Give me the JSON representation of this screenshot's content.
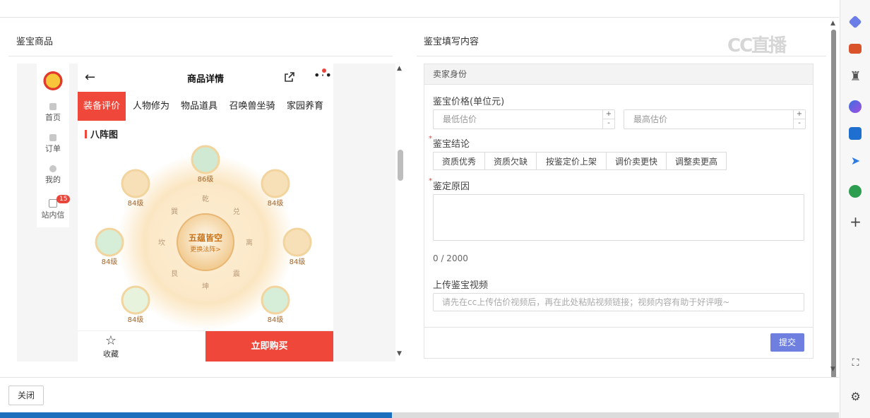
{
  "left_panel": {
    "title": "鉴宝商品"
  },
  "right_panel": {
    "title": "鉴宝填写内容"
  },
  "app_sidebar": {
    "items": [
      {
        "label": "首页"
      },
      {
        "label": "订单"
      },
      {
        "label": "我的"
      },
      {
        "label": "站内信",
        "badge": "15"
      }
    ]
  },
  "phone": {
    "header_title": "商品详情",
    "tabs": [
      {
        "label": "装备评价",
        "active": true
      },
      {
        "label": "人物修为",
        "active": false
      },
      {
        "label": "物品道具",
        "active": false
      },
      {
        "label": "召唤兽坐骑",
        "active": false
      },
      {
        "label": "家园养育",
        "active": false
      }
    ],
    "section_title": "八阵图",
    "formation": {
      "center_title": "五蕴皆空",
      "center_sub": "更换法阵>",
      "nodes": [
        "86级",
        "84级",
        "84级",
        "84级",
        "84级",
        "84级",
        "84级"
      ],
      "trigrams": [
        "乾",
        "兑",
        "离",
        "震",
        "坤",
        "艮",
        "坎",
        "巽"
      ]
    },
    "footer": {
      "fav_label": "收藏",
      "buy_label": "立即购买"
    }
  },
  "form": {
    "section_header": "卖家身份",
    "price_label": "鉴宝价格(单位元)",
    "min_placeholder": "最低估价",
    "max_placeholder": "最高估价",
    "conclusion_label": "鉴宝结论",
    "conclusion_options": [
      "资质优秀",
      "资质欠缺",
      "按鉴定价上架",
      "调价卖更快",
      "调整卖更高"
    ],
    "reason_label": "鉴定原因",
    "counter": "0 / 2000",
    "video_label": "上传鉴宝视频",
    "video_placeholder": "请先在cc上传估价视频后，再在此处粘贴视频链接；视频内容有助于好评哦~",
    "submit_label": "提交"
  },
  "watermark": "CC直播",
  "footer": {
    "close_label": "关闭"
  },
  "colors": {
    "accent_red": "#f0473b",
    "submit_blue": "#6e7fe0"
  },
  "edge_icons": [
    "tag-icon",
    "briefcase-icon",
    "chess-icon",
    "office-icon",
    "outlook-icon",
    "send-icon",
    "tree-icon",
    "plus-icon",
    "screenshot-icon",
    "settings-icon"
  ]
}
